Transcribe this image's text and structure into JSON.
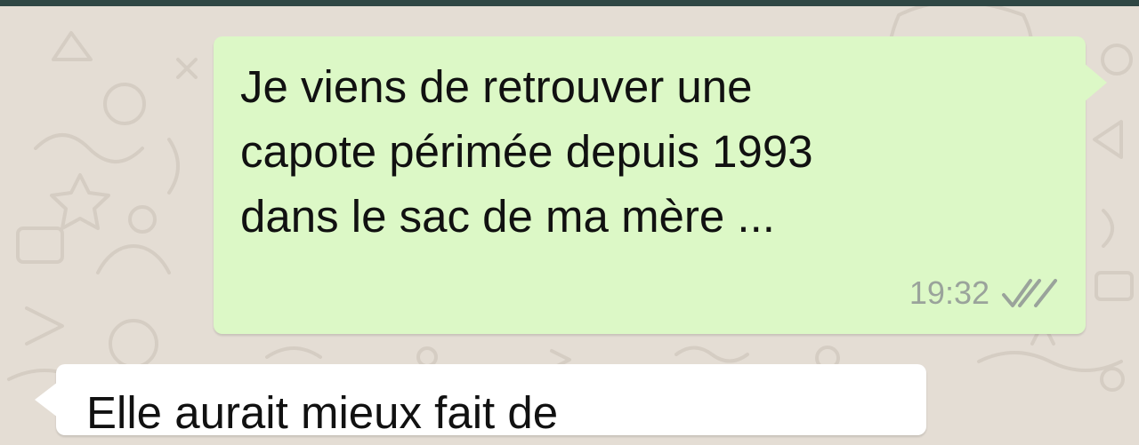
{
  "colors": {
    "wallpaper": "#e4ddd4",
    "top_bar": "#2f4744",
    "outgoing_bubble": "#dcf8c6",
    "incoming_bubble": "#ffffff",
    "timestamp": "#9aa39b",
    "ticks": "#9aa39b"
  },
  "messages": [
    {
      "direction": "outgoing",
      "text": "Je viens de retrouver une capote périmée depuis 1993 dans le sac de ma mère ...",
      "time": "19:32",
      "status_icon": "double-check-icon"
    },
    {
      "direction": "incoming",
      "text": "Elle aurait mieux fait de"
    }
  ]
}
